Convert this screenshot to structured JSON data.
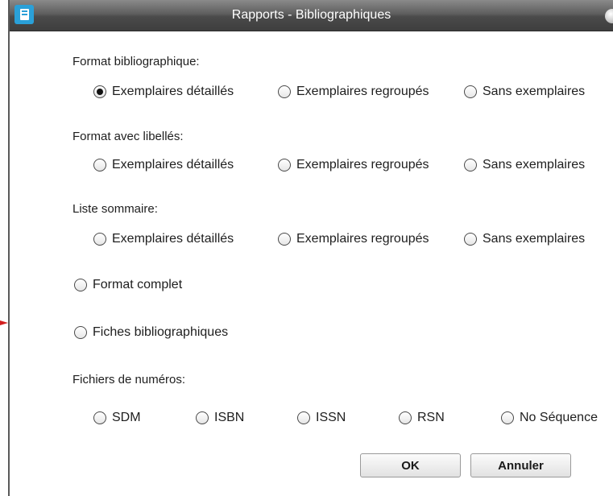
{
  "window": {
    "title": "Rapports - Bibliographiques"
  },
  "sections": [
    {
      "label": "Format bibliographique:",
      "options": [
        {
          "label": "Exemplaires détaillés",
          "checked": true
        },
        {
          "label": "Exemplaires regroupés",
          "checked": false
        },
        {
          "label": "Sans exemplaires",
          "checked": false
        }
      ]
    },
    {
      "label": "Format avec libellés:",
      "options": [
        {
          "label": "Exemplaires détaillés",
          "checked": false
        },
        {
          "label": "Exemplaires regroupés",
          "checked": false
        },
        {
          "label": "Sans exemplaires",
          "checked": false
        }
      ]
    },
    {
      "label": "Liste sommaire:",
      "options": [
        {
          "label": "Exemplaires détaillés",
          "checked": false
        },
        {
          "label": "Exemplaires regroupés",
          "checked": false
        },
        {
          "label": "Sans exemplaires",
          "checked": false
        }
      ]
    }
  ],
  "standalone": [
    {
      "label": "Format complet",
      "checked": false
    },
    {
      "label": "Fiches bibliographiques",
      "checked": false
    }
  ],
  "numbers": {
    "label": "Fichiers de numéros:",
    "options": [
      {
        "label": "SDM",
        "checked": false
      },
      {
        "label": "ISBN",
        "checked": false
      },
      {
        "label": "ISSN",
        "checked": false
      },
      {
        "label": "RSN",
        "checked": false
      },
      {
        "label": "No Séquence",
        "checked": false
      }
    ]
  },
  "buttons": {
    "ok": "OK",
    "cancel": "Annuler"
  },
  "colors": {
    "annotation_arrow": "#d21f1f",
    "app_icon": "#2aa0d8"
  }
}
